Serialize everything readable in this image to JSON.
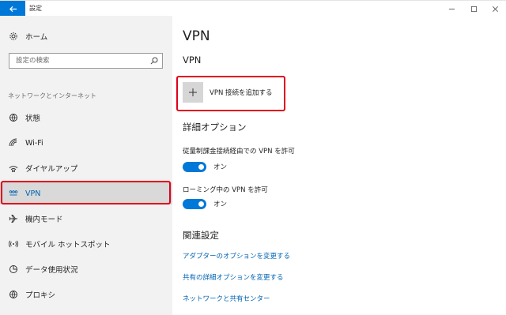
{
  "window": {
    "title": "設定"
  },
  "sidebar": {
    "home_label": "ホーム",
    "search_placeholder": "設定の検索",
    "section_label": "ネットワークとインターネット",
    "items": [
      {
        "label": "状態",
        "icon": "globe-status-icon",
        "active": false
      },
      {
        "label": "Wi-Fi",
        "icon": "wifi-icon",
        "active": false
      },
      {
        "label": "ダイヤルアップ",
        "icon": "dialup-icon",
        "active": false
      },
      {
        "label": "VPN",
        "icon": "vpn-icon",
        "active": true
      },
      {
        "label": "機内モード",
        "icon": "airplane-icon",
        "active": false
      },
      {
        "label": "モバイル ホットスポット",
        "icon": "hotspot-icon",
        "active": false
      },
      {
        "label": "データ使用状況",
        "icon": "data-usage-icon",
        "active": false
      },
      {
        "label": "プロキシ",
        "icon": "globe-icon",
        "active": false
      }
    ]
  },
  "main": {
    "title": "VPN",
    "vpn_heading": "VPN",
    "add_vpn_label": "VPN 接続を追加する",
    "advanced_heading": "詳細オプション",
    "metered_label": "従量制課金接続経由での VPN を許可",
    "metered_toggle": {
      "state": "オン",
      "on": true
    },
    "roaming_label": "ローミング中の VPN を許可",
    "roaming_toggle": {
      "state": "オン",
      "on": true
    },
    "related_heading": "関連設定",
    "links": [
      "アダプターのオプションを変更する",
      "共有の詳細オプションを変更する",
      "ネットワークと共有センター"
    ]
  },
  "colors": {
    "accent": "#0078d7",
    "link": "#0063b1",
    "callout": "#e0001b",
    "sidebar_bg": "#f2f2f2",
    "active_bg": "#d9d9d9"
  }
}
